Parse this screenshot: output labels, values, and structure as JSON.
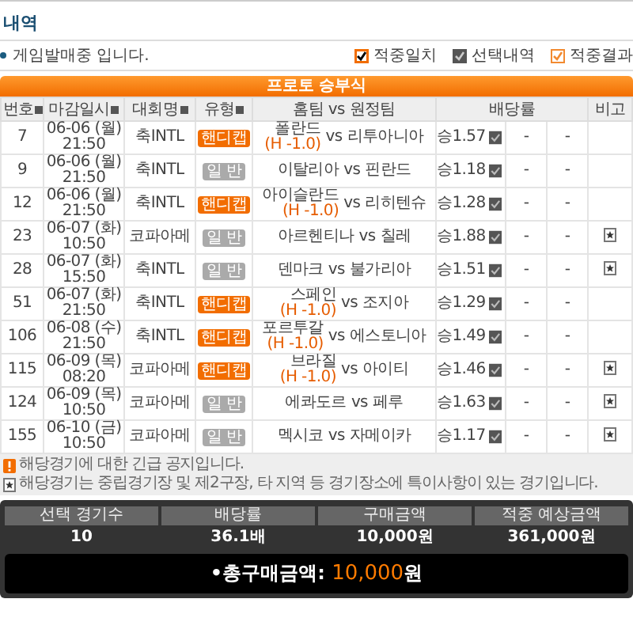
{
  "title": "내역",
  "notice": "게임발매중 입니다.",
  "legend": [
    {
      "kind": "match",
      "label": "적중일치"
    },
    {
      "kind": "selected",
      "label": "선택내역"
    },
    {
      "kind": "result",
      "label": "적중결과"
    }
  ],
  "table": {
    "title": "프로토 승부식",
    "columns": [
      "번호",
      "마감일시",
      "대회명",
      "유형",
      "홈팀 vs 원정팀",
      "배당률",
      "비고"
    ],
    "rows": [
      {
        "no": "7",
        "date": "06-06 (월)",
        "time": "21:50",
        "league": "축INTL",
        "type": {
          "kind": "handicap",
          "label": "핸디캡"
        },
        "home": "폴란드",
        "handicap": "(H -1.0)",
        "vs": "vs",
        "away": "리투아니아",
        "odds": "승1.57",
        "checked": true,
        "draw": "-",
        "lose": "-",
        "special": false
      },
      {
        "no": "9",
        "date": "06-06 (월)",
        "time": "21:50",
        "league": "축INTL",
        "type": {
          "kind": "normal",
          "label": "일 반"
        },
        "home": "이탈리아",
        "vs": "vs",
        "away": "핀란드",
        "odds": "승1.18",
        "checked": true,
        "draw": "-",
        "lose": "-",
        "special": false
      },
      {
        "no": "12",
        "date": "06-06 (월)",
        "time": "21:50",
        "league": "축INTL",
        "type": {
          "kind": "handicap",
          "label": "핸디캡"
        },
        "home": "아이슬란드",
        "handicap": "(H -1.0)",
        "vs": "vs",
        "away": "리히텐슈",
        "odds": "승1.28",
        "checked": true,
        "draw": "-",
        "lose": "-",
        "special": false
      },
      {
        "no": "23",
        "date": "06-07 (화)",
        "time": "10:50",
        "league": "코파아메",
        "type": {
          "kind": "normal",
          "label": "일 반"
        },
        "home": "아르헨티나",
        "vs": "vs",
        "away": "칠레",
        "odds": "승1.88",
        "checked": true,
        "draw": "-",
        "lose": "-",
        "special": true
      },
      {
        "no": "28",
        "date": "06-07 (화)",
        "time": "15:50",
        "league": "축INTL",
        "type": {
          "kind": "normal",
          "label": "일 반"
        },
        "home": "덴마크",
        "vs": "vs",
        "away": "불가리아",
        "odds": "승1.51",
        "checked": true,
        "draw": "-",
        "lose": "-",
        "special": true
      },
      {
        "no": "51",
        "date": "06-07 (화)",
        "time": "21:50",
        "league": "축INTL",
        "type": {
          "kind": "handicap",
          "label": "핸디캡"
        },
        "home": "스페인",
        "handicap": "(H -1.0)",
        "vs": "vs",
        "away": "조지아",
        "odds": "승1.29",
        "checked": true,
        "draw": "-",
        "lose": "-",
        "special": false
      },
      {
        "no": "106",
        "date": "06-08 (수)",
        "time": "21:50",
        "league": "축INTL",
        "type": {
          "kind": "handicap",
          "label": "핸디캡"
        },
        "home": "포르투갈",
        "handicap": "(H -1.0)",
        "vs": "vs",
        "away": "에스토니아",
        "odds": "승1.49",
        "checked": true,
        "draw": "-",
        "lose": "-",
        "special": false
      },
      {
        "no": "115",
        "date": "06-09 (목)",
        "time": "08:20",
        "league": "코파아메",
        "type": {
          "kind": "handicap",
          "label": "핸디캡"
        },
        "home": "브라질",
        "handicap": "(H -1.0)",
        "vs": "vs",
        "away": "아이티",
        "odds": "승1.46",
        "checked": true,
        "draw": "-",
        "lose": "-",
        "special": true
      },
      {
        "no": "124",
        "date": "06-09 (목)",
        "time": "10:50",
        "league": "코파아메",
        "type": {
          "kind": "normal",
          "label": "일 반"
        },
        "home": "에콰도르",
        "vs": "vs",
        "away": "페루",
        "odds": "승1.63",
        "checked": true,
        "draw": "-",
        "lose": "-",
        "special": true
      },
      {
        "no": "155",
        "date": "06-10 (금)",
        "time": "10:50",
        "league": "코파아메",
        "type": {
          "kind": "normal",
          "label": "일 반"
        },
        "home": "멕시코",
        "vs": "vs",
        "away": "자메이카",
        "odds": "승1.17",
        "checked": true,
        "draw": "-",
        "lose": "-",
        "special": true
      }
    ]
  },
  "notes": [
    {
      "kind": "urgent",
      "text": "해당경기에 대한 긴급 공지입니다."
    },
    {
      "kind": "special",
      "text": "해당경기는 중립경기장 및 제2구장, 타 지역 등 경기장소에 특이사항이 있는 경기입니다."
    }
  ],
  "summary": {
    "items": [
      {
        "label": "선택 경기수",
        "value": "10"
      },
      {
        "label": "배당률",
        "value": "36.1배"
      },
      {
        "label": "구매금액",
        "value": "10,000원"
      },
      {
        "label": "적중 예상금액",
        "value": "361,000원"
      }
    ],
    "total_label": "•총구매금액:",
    "total_amount": "10,000",
    "total_unit": "원"
  }
}
